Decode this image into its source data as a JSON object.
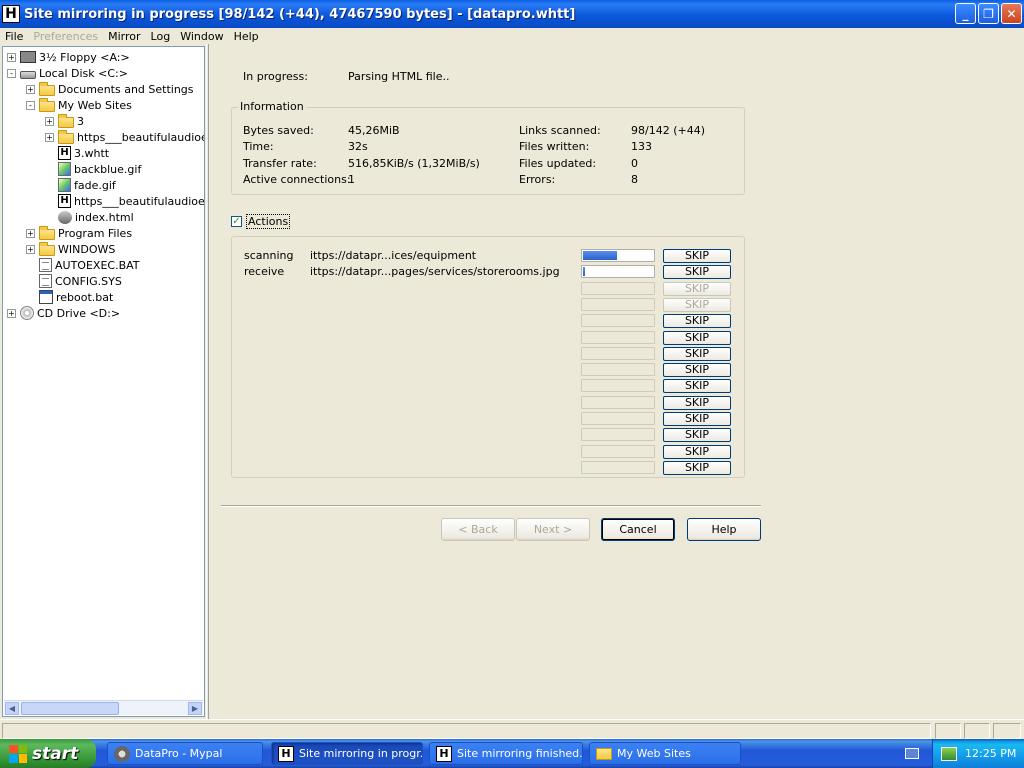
{
  "window": {
    "title": "Site mirroring in progress [98/142 (+44), 47467590 bytes] - [datapro.whtt]",
    "app_icon_letter": "H"
  },
  "menu": [
    "File",
    "Preferences",
    "Mirror",
    "Log",
    "Window",
    "Help"
  ],
  "tree": [
    {
      "label": "3½ Floppy <A:>",
      "icon": "floppy-icon",
      "expander": "+"
    },
    {
      "label": "Local Disk <C:>",
      "icon": "drive-icon",
      "expander": "-"
    },
    {
      "label": "Documents and Settings",
      "icon": "folder-icon",
      "expander": "+"
    },
    {
      "label": "My Web Sites",
      "icon": "folder-icon",
      "expander": "-"
    },
    {
      "label": "3",
      "icon": "folder-icon",
      "expander": "+"
    },
    {
      "label": "https___beautifulaudioed",
      "icon": "folder-icon",
      "expander": "+"
    },
    {
      "label": "3.whtt",
      "icon": "httrack-file-icon",
      "expander": ""
    },
    {
      "label": "backblue.gif",
      "icon": "image-icon",
      "expander": ""
    },
    {
      "label": "fade.gif",
      "icon": "image-icon",
      "expander": ""
    },
    {
      "label": "https___beautifulaudioed",
      "icon": "httrack-file-icon",
      "expander": ""
    },
    {
      "label": "index.html",
      "icon": "html-icon",
      "expander": ""
    },
    {
      "label": "Program Files",
      "icon": "folder-icon",
      "expander": "+"
    },
    {
      "label": "WINDOWS",
      "icon": "folder-icon",
      "expander": "+"
    },
    {
      "label": "AUTOEXEC.BAT",
      "icon": "text-file-icon",
      "expander": ""
    },
    {
      "label": "CONFIG.SYS",
      "icon": "text-file-icon",
      "expander": ""
    },
    {
      "label": "reboot.bat",
      "icon": "batch-file-icon",
      "expander": ""
    },
    {
      "label": "CD Drive <D:>",
      "icon": "cd-icon",
      "expander": "+"
    }
  ],
  "status": {
    "in_progress_label": "In progress:",
    "in_progress_value": "Parsing HTML file.."
  },
  "information": {
    "legend": "Information",
    "left": [
      {
        "label": "Bytes saved:",
        "value": "45,26MiB"
      },
      {
        "label": "Time:",
        "value": "32s"
      },
      {
        "label": "Transfer rate:",
        "value": "516,85KiB/s (1,32MiB/s)"
      },
      {
        "label": "Active connections:",
        "value": "1"
      }
    ],
    "right": [
      {
        "label": "Links scanned:",
        "value": "98/142 (+44)"
      },
      {
        "label": "Files written:",
        "value": "133"
      },
      {
        "label": "Files updated:",
        "value": "0"
      },
      {
        "label": "Errors:",
        "value": "8"
      }
    ]
  },
  "actions": {
    "checkbox_label": "Actions",
    "checked": true,
    "skip_label": "SKIP",
    "rows": [
      {
        "action": "scanning",
        "url": "ittps://datapr...ices/equipment",
        "progress": 0.5,
        "skip_enabled": true
      },
      {
        "action": "receive",
        "url": "ittps://datapr...pages/services/storerooms.jpg",
        "progress": 0.06,
        "skip_enabled": true
      },
      {
        "action": "",
        "url": "",
        "progress": 0,
        "skip_enabled": false
      },
      {
        "action": "",
        "url": "",
        "progress": 0,
        "skip_enabled": false
      },
      {
        "action": "",
        "url": "",
        "progress": 0,
        "skip_enabled": true
      },
      {
        "action": "",
        "url": "",
        "progress": 0,
        "skip_enabled": true
      },
      {
        "action": "",
        "url": "",
        "progress": 0,
        "skip_enabled": true
      },
      {
        "action": "",
        "url": "",
        "progress": 0,
        "skip_enabled": true
      },
      {
        "action": "",
        "url": "",
        "progress": 0,
        "skip_enabled": true
      },
      {
        "action": "",
        "url": "",
        "progress": 0,
        "skip_enabled": true
      },
      {
        "action": "",
        "url": "",
        "progress": 0,
        "skip_enabled": true
      },
      {
        "action": "",
        "url": "",
        "progress": 0,
        "skip_enabled": true
      },
      {
        "action": "",
        "url": "",
        "progress": 0,
        "skip_enabled": true
      },
      {
        "action": "",
        "url": "",
        "progress": 0,
        "skip_enabled": true
      }
    ]
  },
  "wizard_buttons": {
    "back": "< Back",
    "next": "Next >",
    "cancel": "Cancel",
    "help": "Help"
  },
  "taskbar": {
    "start": "start",
    "tasks": [
      {
        "label": "DataPro - Mypal",
        "icon": "browser-icon",
        "active": false
      },
      {
        "label": "Site mirroring in progr...",
        "icon": "httrack-icon",
        "active": true
      },
      {
        "label": "Site mirroring finished...",
        "icon": "httrack-icon",
        "active": false
      },
      {
        "label": "My Web Sites",
        "icon": "folder-icon",
        "active": false
      }
    ],
    "clock": "12:25 PM"
  }
}
